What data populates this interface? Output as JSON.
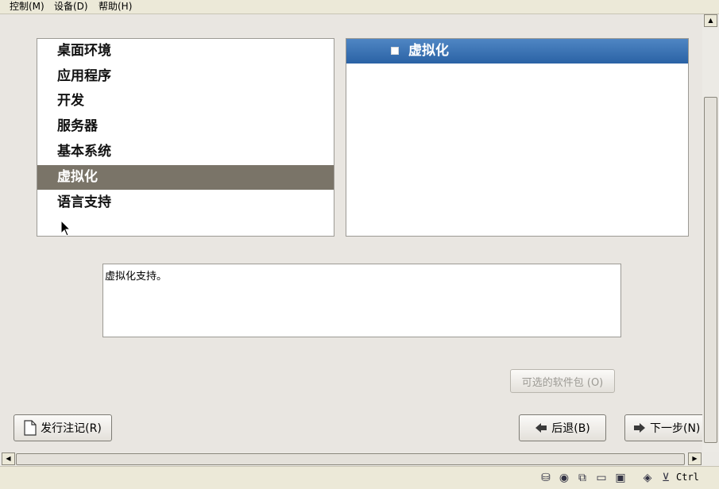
{
  "menubar": {
    "items": [
      {
        "label": "控制(M)"
      },
      {
        "label": "设备(D)"
      },
      {
        "label": "帮助(H)"
      }
    ]
  },
  "categories": {
    "items": [
      {
        "label": "桌面环境"
      },
      {
        "label": "应用程序"
      },
      {
        "label": "开发"
      },
      {
        "label": "服务器"
      },
      {
        "label": "基本系统"
      },
      {
        "label": "虚拟化",
        "selected": true
      },
      {
        "label": "语言支持"
      }
    ]
  },
  "groups": {
    "items": [
      {
        "label": "虚拟化",
        "checked": false,
        "selected": true
      }
    ]
  },
  "description": {
    "text": "虚拟化支持。"
  },
  "buttons": {
    "optional_packages": "可选的软件包 (O)",
    "release_notes": "发行注记(R)",
    "back": "后退(B)",
    "next": "下一步(N)"
  },
  "statusbar": {
    "host_key": "Ctrl",
    "icons": [
      "hard-disk-icon",
      "cd-icon",
      "network-icon",
      "folder-icon",
      "display-icon",
      "mouse-capture-icon",
      "host-key-arrow-icon"
    ]
  },
  "colors": {
    "selected_category_bg": "#7a7468",
    "selected_group_bg": "#2a62a5"
  }
}
